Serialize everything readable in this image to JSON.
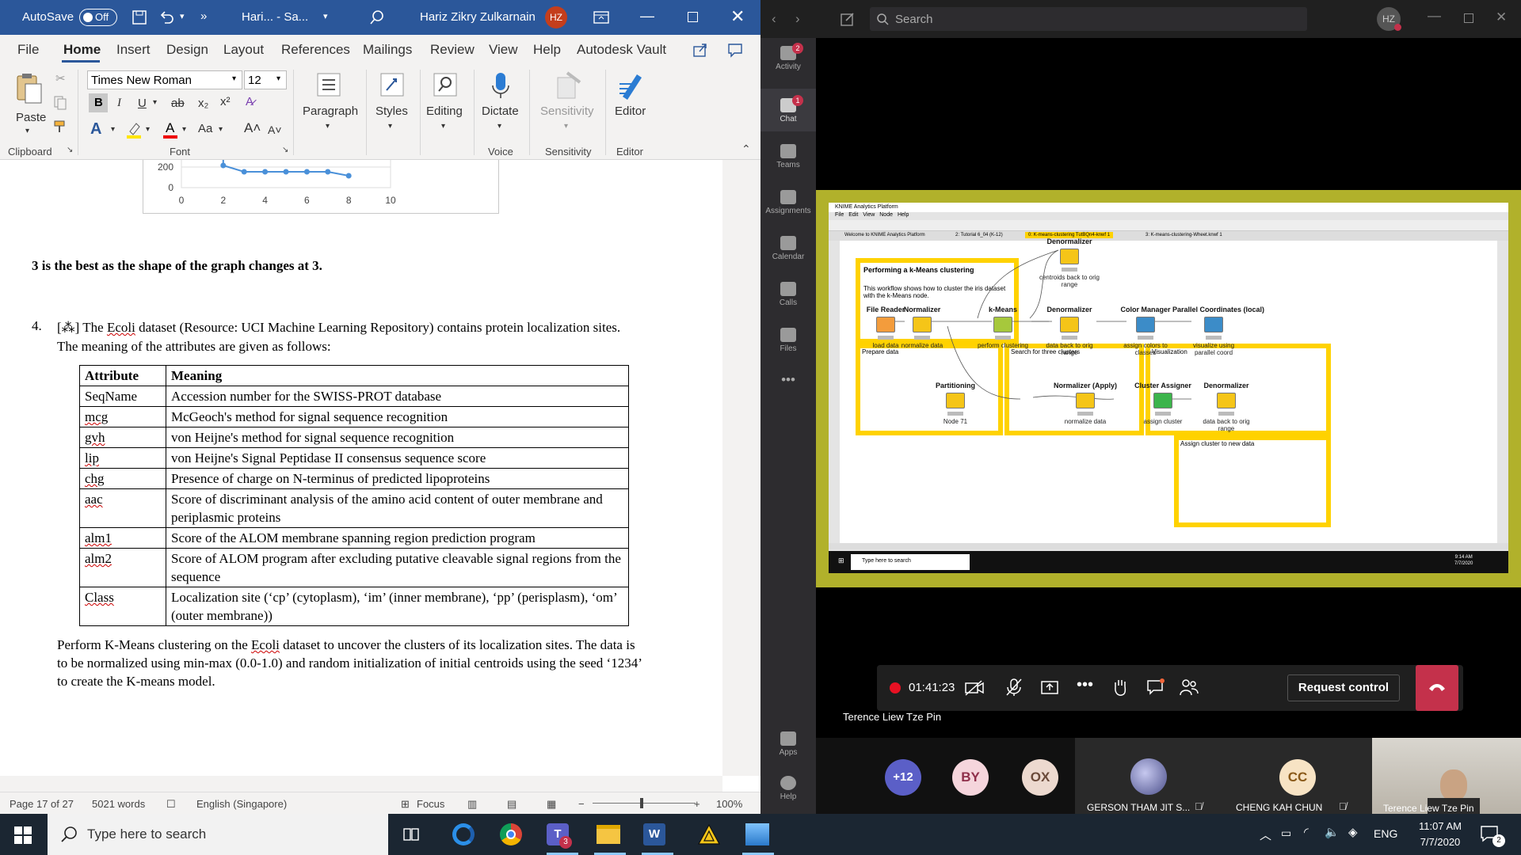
{
  "word": {
    "autosave_label": "AutoSave",
    "autosave_state": "Off",
    "title": "Hari...  - Sa...",
    "user": "Hariz Zikry Zulkarnain",
    "user_initials": "HZ",
    "tabs": [
      "File",
      "Home",
      "Insert",
      "Design",
      "Layout",
      "References",
      "Mailings",
      "Review",
      "View",
      "Help",
      "Autodesk Vault"
    ],
    "ribbon": {
      "paste": "Paste",
      "font_name": "Times New Roman",
      "font_size": "12",
      "paragraph": "Paragraph",
      "styles": "Styles",
      "editing": "Editing",
      "dictate": "Dictate",
      "sensitivity": "Sensitivity",
      "editor": "Editor",
      "groups": {
        "clipboard": "Clipboard",
        "font": "Font",
        "voice": "Voice",
        "sensitivity": "Sensitivity",
        "editor": "Editor"
      }
    },
    "chart": {
      "y_ticks": [
        "200",
        "0"
      ],
      "x_ticks": [
        "0",
        "2",
        "4",
        "6",
        "8",
        "10"
      ]
    },
    "answer": "3 is the best as the shape of the graph changes at 3.",
    "question_number": "4.",
    "question_p1": "The ",
    "question_ecoli": "Ecoli",
    "question_p2": " dataset (Resource: UCI Machine Learning Repository) contains protein localization sites. The meaning of the attributes are given as follows:",
    "table": {
      "headers": [
        "Attribute",
        "Meaning"
      ],
      "rows": [
        [
          "SeqName",
          "Accession number for the SWISS-PROT database"
        ],
        [
          "mcg",
          "McGeoch's method for signal sequence recognition"
        ],
        [
          "gvh",
          "von Heijne's method for signal sequence recognition"
        ],
        [
          "lip",
          "von Heijne's Signal Peptidase II consensus sequence score"
        ],
        [
          "chg",
          "Presence of charge on N-terminus of predicted lipoproteins"
        ],
        [
          "aac",
          "Score of discriminant analysis of the amino acid content of outer membrane and periplasmic proteins"
        ],
        [
          "alm1",
          "Score of the ALOM membrane spanning region prediction program"
        ],
        [
          "alm2",
          "Score of ALOM program after excluding putative cleavable signal regions from the sequence"
        ],
        [
          "Class",
          "Localization site (‘cp’ (cytoplasm), ‘im’ (inner membrane), ‘pp’ (perisplasm), ‘om’ (outer membrane))"
        ]
      ]
    },
    "para_p1": "Perform K-Means clustering on the ",
    "para_ecoli": "Ecoli",
    "para_p2": " dataset to uncover the clusters of its localization sites. The data is to be normalized using min-max (0.0-1.0) and random initialization of initial centroids using the seed ‘1234’ to create the K-means model.",
    "status": {
      "page": "Page 17 of 27",
      "words": "5021 words",
      "language": "English (Singapore)",
      "focus": "Focus",
      "zoom": "100%"
    }
  },
  "teams": {
    "search_placeholder": "Search",
    "user_initials": "HZ",
    "rail": [
      {
        "label": "Activity",
        "badge": "2"
      },
      {
        "label": "Chat",
        "badge": "1"
      },
      {
        "label": "Teams",
        "badge": ""
      },
      {
        "label": "Assignments",
        "badge": ""
      },
      {
        "label": "Calendar",
        "badge": ""
      },
      {
        "label": "Calls",
        "badge": ""
      },
      {
        "label": "Files",
        "badge": ""
      },
      {
        "label": "Apps",
        "badge": ""
      },
      {
        "label": "Help",
        "badge": ""
      }
    ],
    "call_timer": "01:41:23",
    "request_control": "Request control",
    "presenter": "Terence Liew Tze Pin",
    "participants": [
      {
        "label": "+12",
        "color": "#5b5fc7"
      },
      {
        "label": "BY",
        "color": "#f5d5dc"
      },
      {
        "label": "OX",
        "color": "#ecd9cf"
      }
    ],
    "tiles": [
      {
        "name": "GERSON THAM JIT S..."
      },
      {
        "name": "CHENG KAH CHUN",
        "initials": "CC"
      },
      {
        "name": "Terence Liew Tze Pin"
      }
    ]
  },
  "knime": {
    "window_title": "KNIME Analytics Platform",
    "menu": [
      "File",
      "Edit",
      "View",
      "Node",
      "Help"
    ],
    "tabs": [
      "Welcome to KNIME Analytics Platform",
      "2: Tutorial 6_04 (K-12)",
      "0: K-means-clustering TutBQn4-knwf 1",
      "3: K-means-clustering-Wheet.knwf 1"
    ],
    "desc_title": "Performing a k-Means clustering",
    "desc_body": "This workflow shows how to cluster the iris dataset with the k-Means node.",
    "sections": [
      "Prepare data",
      "Search for three clusters",
      "Visualization",
      "Assign cluster to new data"
    ],
    "nodes": [
      {
        "title": "Denormalizer",
        "sub": "centroids back to orig range",
        "color": "#f5c518"
      },
      {
        "title": "File Reader",
        "sub": "load data",
        "color": "#f39c3c"
      },
      {
        "title": "Normalizer",
        "sub": "normalize data",
        "color": "#f5c518"
      },
      {
        "title": "k-Means",
        "sub": "perform clustering",
        "color": "#a6c83c"
      },
      {
        "title": "Denormalizer",
        "sub": "data back to orig range",
        "color": "#f5c518"
      },
      {
        "title": "Color Manager",
        "sub": "assign colors to classes",
        "color": "#3c8cc8"
      },
      {
        "title": "Parallel Coordinates (local)",
        "sub": "visualize using parallel coord",
        "color": "#3c8cc8"
      },
      {
        "title": "Partitioning",
        "sub": "Node 71",
        "color": "#f5c518"
      },
      {
        "title": "Normalizer (Apply)",
        "sub": "normalize data",
        "color": "#f5c518"
      },
      {
        "title": "Cluster Assigner",
        "sub": "assign cluster",
        "color": "#3cb44b"
      },
      {
        "title": "Denormalizer",
        "sub": "data back to orig range",
        "color": "#f5c518"
      }
    ],
    "taskbar_search": "Type here to search",
    "clock_time": "9:14 AM",
    "clock_date": "7/7/2020"
  },
  "taskbar": {
    "search_placeholder": "Type here to search",
    "language": "ENG",
    "time": "11:07 AM",
    "date": "7/7/2020",
    "notification_count": "2",
    "teams_badge": "3"
  }
}
